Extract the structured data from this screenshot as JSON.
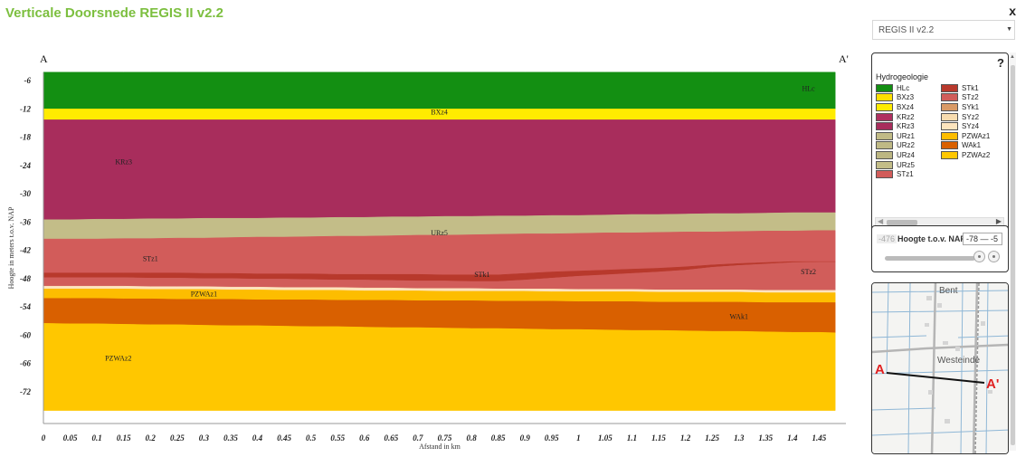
{
  "header": {
    "title": "Verticale Doorsnede REGIS II v2.2",
    "close_label": "x"
  },
  "section": {
    "start_label": "A",
    "end_label": "A'"
  },
  "sidebar": {
    "model_select": {
      "value": "REGIS II v2.2"
    },
    "legend": {
      "help_label": "?",
      "heading": "Hydrogeologie",
      "col1": [
        {
          "label": "HLc",
          "color": "#138f12"
        },
        {
          "label": "BXz3",
          "color": "#ffe000"
        },
        {
          "label": "BXz4",
          "color": "#ffeb00"
        },
        {
          "label": "KRz2",
          "color": "#b03060"
        },
        {
          "label": "KRz3",
          "color": "#a82d5c"
        },
        {
          "label": "URz1",
          "color": "#c1bb86"
        },
        {
          "label": "URz2",
          "color": "#bfb985"
        },
        {
          "label": "URz4",
          "color": "#bcb682"
        },
        {
          "label": "URz5",
          "color": "#c3bd88"
        },
        {
          "label": "STz1",
          "color": "#d25c5a"
        }
      ],
      "col2": [
        {
          "label": "STk1",
          "color": "#b8392c"
        },
        {
          "label": "STz2",
          "color": "#d15d5a"
        },
        {
          "label": "SYk1",
          "color": "#d99a66"
        },
        {
          "label": "SYz2",
          "color": "#f8dcaf"
        },
        {
          "label": "SYz4",
          "color": "#fde4bd"
        },
        {
          "label": "PZWAz1",
          "color": "#fdbd00"
        },
        {
          "label": "WAk1",
          "color": "#d96000"
        },
        {
          "label": "PZWAz2",
          "color": "#ffc700"
        }
      ]
    },
    "height_filter": {
      "min_value": "-476",
      "label": "Hoogte t.o.v. NAP",
      "range_text": "-78 — -5"
    },
    "map": {
      "places": [
        "Bent",
        "Westeinde"
      ],
      "start_label": "A",
      "end_label": "A'"
    }
  },
  "chart_data": {
    "type": "area",
    "title": "Verticale Doorsnede REGIS II v2.2",
    "xlabel": "Afstand in km",
    "ylabel": "Hoogte in meters t.o.v. NAP",
    "xlim": [
      0,
      1.5
    ],
    "ylim": [
      -78,
      -5
    ],
    "x_ticks": [
      "0",
      "0.05",
      "0.1",
      "0.15",
      "0.2",
      "0.25",
      "0.3",
      "0.35",
      "0.4",
      "0.45",
      "0.5",
      "0.55",
      "0.6",
      "0.65",
      "0.7",
      "0.75",
      "0.8",
      "0.85",
      "0.9",
      "0.95",
      "1",
      "1.05",
      "1.1",
      "1.15",
      "1.2",
      "1.25",
      "1.3",
      "1.35",
      "1.4",
      "1.45"
    ],
    "y_ticks": [
      -6,
      -12,
      -18,
      -24,
      -30,
      -36,
      -42,
      -48,
      -54,
      -60,
      -66,
      -72
    ],
    "x": [
      0,
      0.05,
      0.1,
      0.15,
      0.2,
      0.25,
      0.3,
      0.35,
      0.4,
      0.45,
      0.5,
      0.55,
      0.6,
      0.65,
      0.7,
      0.75,
      0.8,
      0.85,
      0.9,
      0.95,
      1,
      1.05,
      1.1,
      1.15,
      1.2,
      1.25,
      1.3,
      1.35,
      1.4,
      1.45,
      1.48
    ],
    "surface": [
      -4.2,
      -4.2,
      -4.2,
      -4.2,
      -4.2,
      -4.2,
      -4.2,
      -4.2,
      -4.2,
      -4.2,
      -4.2,
      -4.2,
      -4.2,
      -4.2,
      -4.2,
      -4.2,
      -4.2,
      -4.2,
      -4.2,
      -4.2,
      -4.2,
      -4.2,
      -4.2,
      -4.2,
      -4.2,
      -4.2,
      -4.2,
      -4.2,
      -4.2,
      -4.2,
      -4.2
    ],
    "layers": [
      {
        "name": "HLc",
        "color": "#138f12",
        "bottom": [
          -12,
          -12,
          -12,
          -12,
          -12,
          -12,
          -12,
          -12,
          -12,
          -12,
          -12,
          -12,
          -12,
          -12,
          -12,
          -12,
          -12,
          -12,
          -12,
          -12,
          -12,
          -12,
          -12,
          -12,
          -12,
          -12,
          -12,
          -12,
          -12,
          -12,
          -12
        ]
      },
      {
        "name": "BXz4",
        "color": "#ffeb00",
        "bottom": [
          -14.3,
          -14.3,
          -14.3,
          -14.3,
          -14.3,
          -14.3,
          -14.3,
          -14.3,
          -14.3,
          -14.3,
          -14.3,
          -14.3,
          -14.3,
          -14.3,
          -14.3,
          -14.3,
          -14.3,
          -14.3,
          -14.3,
          -14.3,
          -14.3,
          -14.3,
          -14.3,
          -14.3,
          -14.3,
          -14.3,
          -14.3,
          -14.3,
          -14.3,
          -14.3,
          -14.3
        ]
      },
      {
        "name": "KRz3",
        "color": "#a82d5c",
        "bottom": [
          -35.5,
          -35.5,
          -35.4,
          -35.4,
          -35.3,
          -35.3,
          -35.2,
          -35.2,
          -35.2,
          -35.1,
          -35.1,
          -35,
          -35,
          -34.9,
          -34.9,
          -34.8,
          -34.8,
          -34.7,
          -34.7,
          -34.6,
          -34.6,
          -34.5,
          -34.4,
          -34.4,
          -34.3,
          -34.2,
          -34.2,
          -34.1,
          -34,
          -34,
          -34
        ]
      },
      {
        "name": "URz5",
        "color": "#c3bd88",
        "bottom": [
          -39.6,
          -39.6,
          -39.6,
          -39.5,
          -39.5,
          -39.4,
          -39.4,
          -39.3,
          -39.2,
          -39.2,
          -39.1,
          -39,
          -39,
          -38.9,
          -38.8,
          -38.8,
          -38.7,
          -38.6,
          -38.5,
          -38.5,
          -38.4,
          -38.3,
          -38.3,
          -38.2,
          -38.1,
          -38.1,
          -38,
          -37.9,
          -37.9,
          -37.8,
          -37.8
        ]
      },
      {
        "name": "STz1",
        "color": "#d25c5a",
        "bottom": [
          -46.8,
          -46.8,
          -46.8,
          -46.8,
          -46.8,
          -46.8,
          -46.9,
          -46.9,
          -47,
          -47,
          -47,
          -47.1,
          -47.1,
          -47.1,
          -47.1,
          -47.2,
          -47.2,
          -47.2,
          -46.9,
          -46.6,
          -46.4,
          -46.2,
          -46,
          -45.8,
          -45.5,
          -45.1,
          -44.8,
          -44.6,
          -44.4,
          -44.4,
          -44.4
        ]
      },
      {
        "name": "STk1",
        "color": "#b8392c",
        "bottom": [
          -47.8,
          -47.8,
          -47.8,
          -47.8,
          -47.9,
          -47.9,
          -48,
          -48,
          -48.1,
          -48.1,
          -48.2,
          -48.3,
          -48.3,
          -48.4,
          -48.5,
          -48.5,
          -48.6,
          -48.6,
          -48.3,
          -47.9,
          -47.5,
          -47.2,
          -46.9,
          -46.6,
          -46.2,
          -45.6,
          -45.2,
          -44.9,
          -44.6,
          -44.5,
          -44.5
        ]
      },
      {
        "name": "STz2",
        "color": "#d15d5a",
        "bottom": [
          -49.6,
          -49.6,
          -49.6,
          -49.6,
          -49.7,
          -49.7,
          -49.7,
          -49.8,
          -49.8,
          -49.9,
          -49.9,
          -49.9,
          -50,
          -50,
          -50.1,
          -50.1,
          -50.1,
          -50.2,
          -50.2,
          -50.2,
          -50.3,
          -50.3,
          -50.3,
          -50.4,
          -50.4,
          -50.4,
          -50.4,
          -50.5,
          -50.5,
          -50.5,
          -50.5
        ]
      },
      {
        "name": "SYz4",
        "color": "#fde4bd",
        "bottom": [
          -50.2,
          -50.2,
          -50.2,
          -50.2,
          -50.3,
          -50.3,
          -50.3,
          -50.4,
          -50.4,
          -50.5,
          -50.5,
          -50.5,
          -50.6,
          -50.6,
          -50.6,
          -50.7,
          -50.7,
          -50.7,
          -50.7,
          -50.8,
          -50.8,
          -50.8,
          -50.8,
          -50.9,
          -50.9,
          -50.9,
          -50.9,
          -51,
          -51,
          -51,
          -51
        ]
      },
      {
        "name": "PZWAz1",
        "color": "#fdbd00",
        "bottom": [
          -52.2,
          -52.2,
          -52.2,
          -52.3,
          -52.3,
          -52.4,
          -52.4,
          -52.4,
          -52.5,
          -52.5,
          -52.5,
          -52.6,
          -52.6,
          -52.6,
          -52.7,
          -52.7,
          -52.7,
          -52.8,
          -52.8,
          -52.8,
          -52.9,
          -52.9,
          -52.9,
          -53,
          -53,
          -53,
          -53,
          -53.1,
          -53.1,
          -53.1,
          -53.1
        ]
      },
      {
        "name": "WAk1",
        "color": "#d96000",
        "bottom": [
          -57.5,
          -57.6,
          -57.6,
          -57.7,
          -57.8,
          -57.8,
          -57.9,
          -58,
          -58,
          -58.1,
          -58.2,
          -58.2,
          -58.3,
          -58.4,
          -58.4,
          -58.5,
          -58.6,
          -58.6,
          -58.7,
          -58.8,
          -58.8,
          -58.9,
          -59,
          -59,
          -59.1,
          -59.2,
          -59.2,
          -59.3,
          -59.4,
          -59.4,
          -59.5
        ]
      },
      {
        "name": "PZWAz2",
        "color": "#ffc700",
        "bottom": [
          -76,
          -76,
          -76,
          -76,
          -76,
          -76,
          -76,
          -76,
          -76,
          -76,
          -76,
          -76,
          -76,
          -76,
          -76,
          -76,
          -76,
          -76,
          -76,
          -76,
          -76,
          -76,
          -76,
          -76,
          -76,
          -76,
          -76,
          -76,
          -76,
          -76,
          -76
        ]
      }
    ],
    "annotations": [
      {
        "text": "HLc",
        "x": 1.43,
        "y": -8.2
      },
      {
        "text": "BXz4",
        "x": 0.74,
        "y": -13.2
      },
      {
        "text": "KRz3",
        "x": 0.15,
        "y": -23.7
      },
      {
        "text": "URz5",
        "x": 0.74,
        "y": -38.8
      },
      {
        "text": "STz1",
        "x": 0.2,
        "y": -44.3
      },
      {
        "text": "STk1",
        "x": 0.82,
        "y": -47.6
      },
      {
        "text": "STz2",
        "x": 1.43,
        "y": -47.1
      },
      {
        "text": "PZWAz1",
        "x": 0.3,
        "y": -51.8
      },
      {
        "text": "WAk1",
        "x": 1.3,
        "y": -56.6
      },
      {
        "text": "PZWAz2",
        "x": 0.14,
        "y": -65.4
      }
    ],
    "grid": false
  }
}
